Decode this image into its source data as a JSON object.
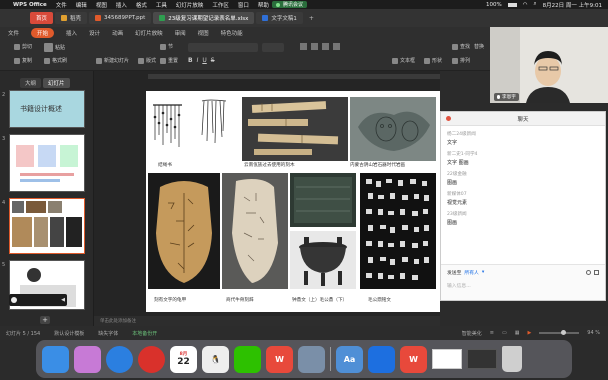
{
  "menubar": {
    "app_name": "WPS Office",
    "items": [
      "文件",
      "编辑",
      "视图",
      "插入",
      "格式",
      "工具",
      "幻灯片放映",
      "工作区",
      "窗口",
      "帮助"
    ],
    "meeting_label": "腾讯会议",
    "battery": "100%",
    "datetime": "8月22日 周一 上午9:01"
  },
  "tabs": [
    {
      "label": "首页",
      "color": "#d84a3a"
    },
    {
      "label": "稻壳",
      "color": "#e0a030"
    },
    {
      "label": "345689PPT.ppt",
      "color": "#e05a2b"
    },
    {
      "label": "23级复习课期望记录表名单.xlsx",
      "color": "#2e9d4f"
    },
    {
      "label": "文字文稿1",
      "color": "#2f6fd6"
    }
  ],
  "ribbon_tabs": [
    "文件",
    "开始",
    "插入",
    "设计",
    "动画",
    "幻灯片放映",
    "审阅",
    "视图",
    "特色功能"
  ],
  "ribbon_buttons": [
    "剪切",
    "复制",
    "粘贴",
    "格式刷",
    "新建幻灯片",
    "版式",
    "节",
    "重置",
    "文本框",
    "形状",
    "排列",
    "查找",
    "替换"
  ],
  "panel_tabs": [
    "大纲",
    "幻灯片"
  ],
  "thumbnails": [
    {
      "num": "2",
      "title": "书籍设计概述"
    },
    {
      "num": "3",
      "title": ""
    },
    {
      "num": "4",
      "title": ""
    },
    {
      "num": "5",
      "title": ""
    }
  ],
  "slide": {
    "captions": [
      "结绳书",
      "云南佤族过去使用的刻木",
      "内蒙古阴山岩石器时代岩画",
      "刻有文字的龟甲",
      "商代牛骨刻辞",
      "钟鼎文（上）毛公鼎（下）",
      "毛公鼎铭文"
    ]
  },
  "notes_placeholder": "单击此处添加备注",
  "status": {
    "slide_counter": "幻灯片 5 / 154",
    "theme": "默认设计模板",
    "font_state": "缺失字体",
    "backup": "本地备份开",
    "smart_beautify": "智能美化",
    "zoom": "94 %"
  },
  "video": {
    "speaking_label": "正在讲话：李恩宇;",
    "participant_name": "李恩宇"
  },
  "chat": {
    "title": "聊天",
    "messages": [
      {
        "name": "杨二24级新闻",
        "text": "文字"
      },
      {
        "name": "新二史1-同学4",
        "text": "文字 图画"
      },
      {
        "name": "22级金融",
        "text": "图画"
      },
      {
        "name": "新媒体07",
        "text": "视觉元素"
      },
      {
        "name": "23级新闻",
        "text": "图画"
      }
    ],
    "send_to_label": "发送至",
    "send_to_value": "所有人",
    "input_placeholder": "输入信息..."
  },
  "dock": [
    {
      "name": "finder",
      "label": "",
      "color": "#3a8ee6"
    },
    {
      "name": "launchpad",
      "label": "",
      "color": "#c77ad6"
    },
    {
      "name": "safari",
      "label": "",
      "color": "#2b7fe0"
    },
    {
      "name": "netease-music",
      "label": "",
      "color": "#d9312b"
    },
    {
      "name": "calendar",
      "label": "22",
      "color": "#ffffff"
    },
    {
      "name": "qq",
      "label": "",
      "color": "#222222"
    },
    {
      "name": "wechat",
      "label": "",
      "color": "#2dc100"
    },
    {
      "name": "wps",
      "label": "W",
      "color": "#e8493b"
    },
    {
      "name": "preview",
      "label": "",
      "color": "#7a8fa8"
    },
    {
      "name": "dictionary",
      "label": "Aa",
      "color": "#4f8fd6"
    },
    {
      "name": "tencent-meeting",
      "label": "",
      "color": "#1d6fe0"
    },
    {
      "name": "wps-2",
      "label": "W",
      "color": "#e8493b"
    }
  ],
  "calendar_month": "8月"
}
